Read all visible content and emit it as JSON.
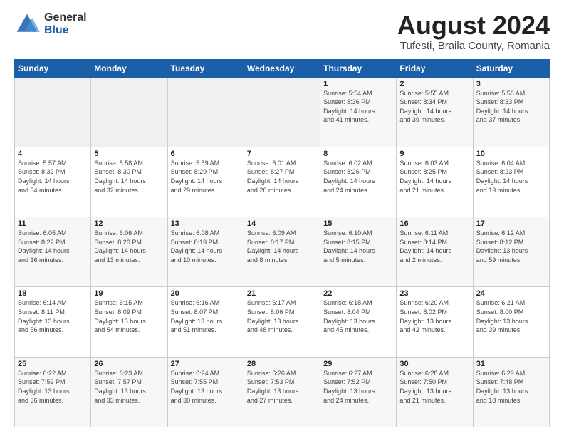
{
  "header": {
    "logo_general": "General",
    "logo_blue": "Blue",
    "month_title": "August 2024",
    "location": "Tufesti, Braila County, Romania"
  },
  "weekdays": [
    "Sunday",
    "Monday",
    "Tuesday",
    "Wednesday",
    "Thursday",
    "Friday",
    "Saturday"
  ],
  "weeks": [
    [
      {
        "day": "",
        "info": ""
      },
      {
        "day": "",
        "info": ""
      },
      {
        "day": "",
        "info": ""
      },
      {
        "day": "",
        "info": ""
      },
      {
        "day": "1",
        "info": "Sunrise: 5:54 AM\nSunset: 8:36 PM\nDaylight: 14 hours\nand 41 minutes."
      },
      {
        "day": "2",
        "info": "Sunrise: 5:55 AM\nSunset: 8:34 PM\nDaylight: 14 hours\nand 39 minutes."
      },
      {
        "day": "3",
        "info": "Sunrise: 5:56 AM\nSunset: 8:33 PM\nDaylight: 14 hours\nand 37 minutes."
      }
    ],
    [
      {
        "day": "4",
        "info": "Sunrise: 5:57 AM\nSunset: 8:32 PM\nDaylight: 14 hours\nand 34 minutes."
      },
      {
        "day": "5",
        "info": "Sunrise: 5:58 AM\nSunset: 8:30 PM\nDaylight: 14 hours\nand 32 minutes."
      },
      {
        "day": "6",
        "info": "Sunrise: 5:59 AM\nSunset: 8:29 PM\nDaylight: 14 hours\nand 29 minutes."
      },
      {
        "day": "7",
        "info": "Sunrise: 6:01 AM\nSunset: 8:27 PM\nDaylight: 14 hours\nand 26 minutes."
      },
      {
        "day": "8",
        "info": "Sunrise: 6:02 AM\nSunset: 8:26 PM\nDaylight: 14 hours\nand 24 minutes."
      },
      {
        "day": "9",
        "info": "Sunrise: 6:03 AM\nSunset: 8:25 PM\nDaylight: 14 hours\nand 21 minutes."
      },
      {
        "day": "10",
        "info": "Sunrise: 6:04 AM\nSunset: 8:23 PM\nDaylight: 14 hours\nand 19 minutes."
      }
    ],
    [
      {
        "day": "11",
        "info": "Sunrise: 6:05 AM\nSunset: 8:22 PM\nDaylight: 14 hours\nand 16 minutes."
      },
      {
        "day": "12",
        "info": "Sunrise: 6:06 AM\nSunset: 8:20 PM\nDaylight: 14 hours\nand 13 minutes."
      },
      {
        "day": "13",
        "info": "Sunrise: 6:08 AM\nSunset: 8:19 PM\nDaylight: 14 hours\nand 10 minutes."
      },
      {
        "day": "14",
        "info": "Sunrise: 6:09 AM\nSunset: 8:17 PM\nDaylight: 14 hours\nand 8 minutes."
      },
      {
        "day": "15",
        "info": "Sunrise: 6:10 AM\nSunset: 8:15 PM\nDaylight: 14 hours\nand 5 minutes."
      },
      {
        "day": "16",
        "info": "Sunrise: 6:11 AM\nSunset: 8:14 PM\nDaylight: 14 hours\nand 2 minutes."
      },
      {
        "day": "17",
        "info": "Sunrise: 6:12 AM\nSunset: 8:12 PM\nDaylight: 13 hours\nand 59 minutes."
      }
    ],
    [
      {
        "day": "18",
        "info": "Sunrise: 6:14 AM\nSunset: 8:11 PM\nDaylight: 13 hours\nand 56 minutes."
      },
      {
        "day": "19",
        "info": "Sunrise: 6:15 AM\nSunset: 8:09 PM\nDaylight: 13 hours\nand 54 minutes."
      },
      {
        "day": "20",
        "info": "Sunrise: 6:16 AM\nSunset: 8:07 PM\nDaylight: 13 hours\nand 51 minutes."
      },
      {
        "day": "21",
        "info": "Sunrise: 6:17 AM\nSunset: 8:06 PM\nDaylight: 13 hours\nand 48 minutes."
      },
      {
        "day": "22",
        "info": "Sunrise: 6:18 AM\nSunset: 8:04 PM\nDaylight: 13 hours\nand 45 minutes."
      },
      {
        "day": "23",
        "info": "Sunrise: 6:20 AM\nSunset: 8:02 PM\nDaylight: 13 hours\nand 42 minutes."
      },
      {
        "day": "24",
        "info": "Sunrise: 6:21 AM\nSunset: 8:00 PM\nDaylight: 13 hours\nand 39 minutes."
      }
    ],
    [
      {
        "day": "25",
        "info": "Sunrise: 6:22 AM\nSunset: 7:59 PM\nDaylight: 13 hours\nand 36 minutes."
      },
      {
        "day": "26",
        "info": "Sunrise: 6:23 AM\nSunset: 7:57 PM\nDaylight: 13 hours\nand 33 minutes."
      },
      {
        "day": "27",
        "info": "Sunrise: 6:24 AM\nSunset: 7:55 PM\nDaylight: 13 hours\nand 30 minutes."
      },
      {
        "day": "28",
        "info": "Sunrise: 6:26 AM\nSunset: 7:53 PM\nDaylight: 13 hours\nand 27 minutes."
      },
      {
        "day": "29",
        "info": "Sunrise: 6:27 AM\nSunset: 7:52 PM\nDaylight: 13 hours\nand 24 minutes."
      },
      {
        "day": "30",
        "info": "Sunrise: 6:28 AM\nSunset: 7:50 PM\nDaylight: 13 hours\nand 21 minutes."
      },
      {
        "day": "31",
        "info": "Sunrise: 6:29 AM\nSunset: 7:48 PM\nDaylight: 13 hours\nand 18 minutes."
      }
    ]
  ]
}
